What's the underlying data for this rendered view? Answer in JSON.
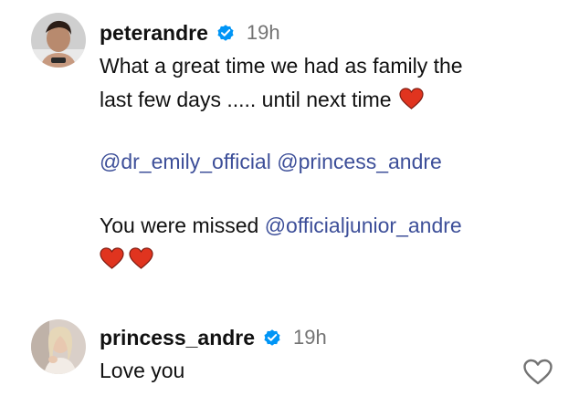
{
  "comments": [
    {
      "username": "peterandre",
      "time": "19h",
      "line1": "What a great time we had  as family the",
      "line2": "last few days ..... until next time",
      "mention1": "@dr_emily_official",
      "mention2": "@princess_andre",
      "missed_text": "You were missed ",
      "mention3": "@officialjunior_andre"
    },
    {
      "username": "princess_andre",
      "time": "19h",
      "text": "Love you"
    }
  ],
  "icons": {
    "verified": "verified-badge-icon",
    "heart": "red-heart-emoji",
    "like": "heart-outline-icon"
  },
  "colors": {
    "verified_blue": "#0095f6",
    "mention": "#3d4f99",
    "heart_red": "#e0341f",
    "timestamp": "#737373"
  }
}
